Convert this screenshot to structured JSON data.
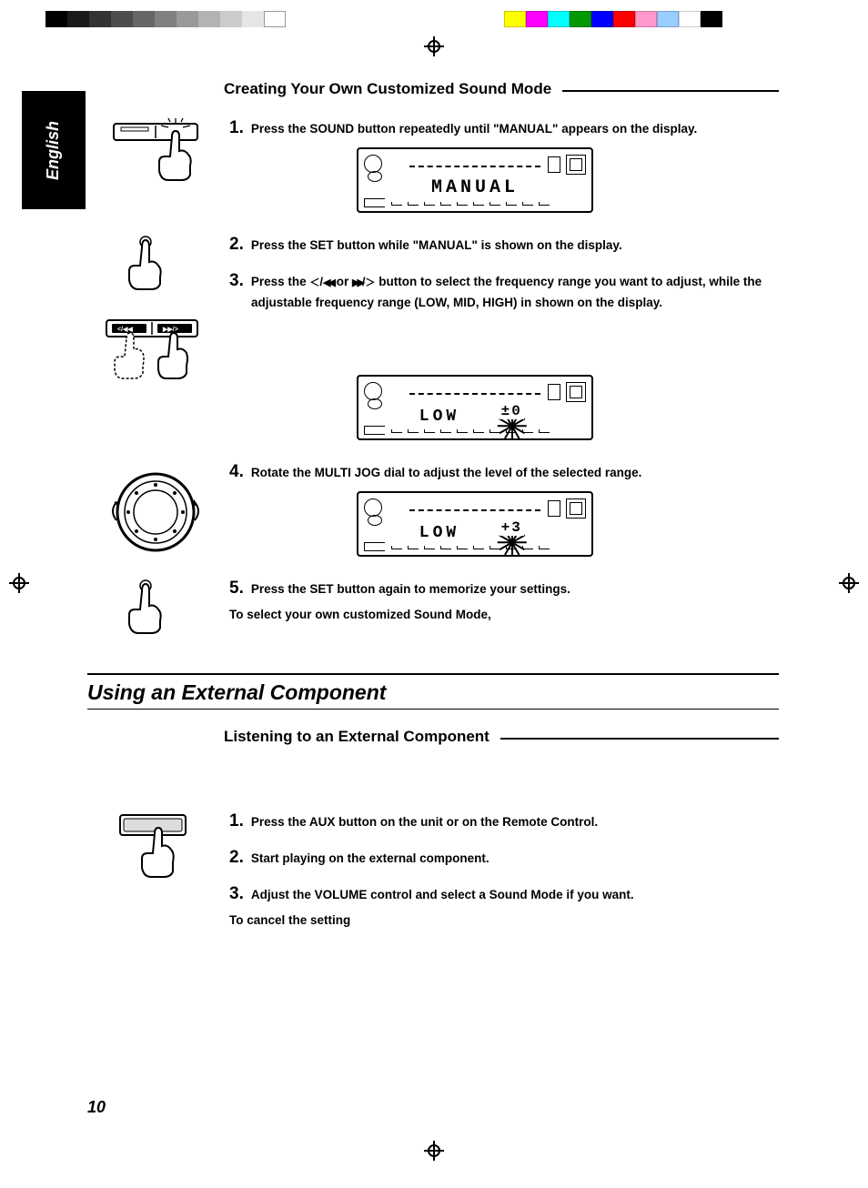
{
  "lang_tab": "English",
  "page_number": "10",
  "section1": {
    "subhead": "Creating Your Own Customized Sound Mode",
    "steps": {
      "s1": {
        "num": "1.",
        "text": "Press the SOUND button repeatedly until \"MANUAL\" appears on the display."
      },
      "s2": {
        "num": "2.",
        "text": "Press the SET button while \"MANUAL\" is shown on the display."
      },
      "s3": {
        "num": "3.",
        "text_a": "Press the ",
        "text_b": " or ",
        "text_c": " button to select the frequency range you want to adjust, while the",
        "text_d": "adjustable frequency range (LOW, MID, HIGH) in shown on the display."
      },
      "s4": {
        "num": "4.",
        "text": "Rotate the MULTI JOG dial to adjust the level of the selected range."
      },
      "s5": {
        "num": "5.",
        "text": "Press the SET button again to memorize your settings."
      }
    },
    "note": "To select your own customized Sound Mode,",
    "display1": "MANUAL",
    "display2_label": "LOW",
    "display2_value": "±0",
    "display3_label": "LOW",
    "display3_value": "+3"
  },
  "section2": {
    "title": "Using an External Component",
    "subhead": "Listening to an External Component",
    "steps": {
      "s1": {
        "num": "1.",
        "text": "Press the AUX button on the unit or on the Remote Control."
      },
      "s2": {
        "num": "2.",
        "text": "Start playing on the external component."
      },
      "s3": {
        "num": "3.",
        "text": "Adjust the VOLUME control and select a Sound Mode if you want."
      }
    },
    "note": "To cancel the setting"
  }
}
